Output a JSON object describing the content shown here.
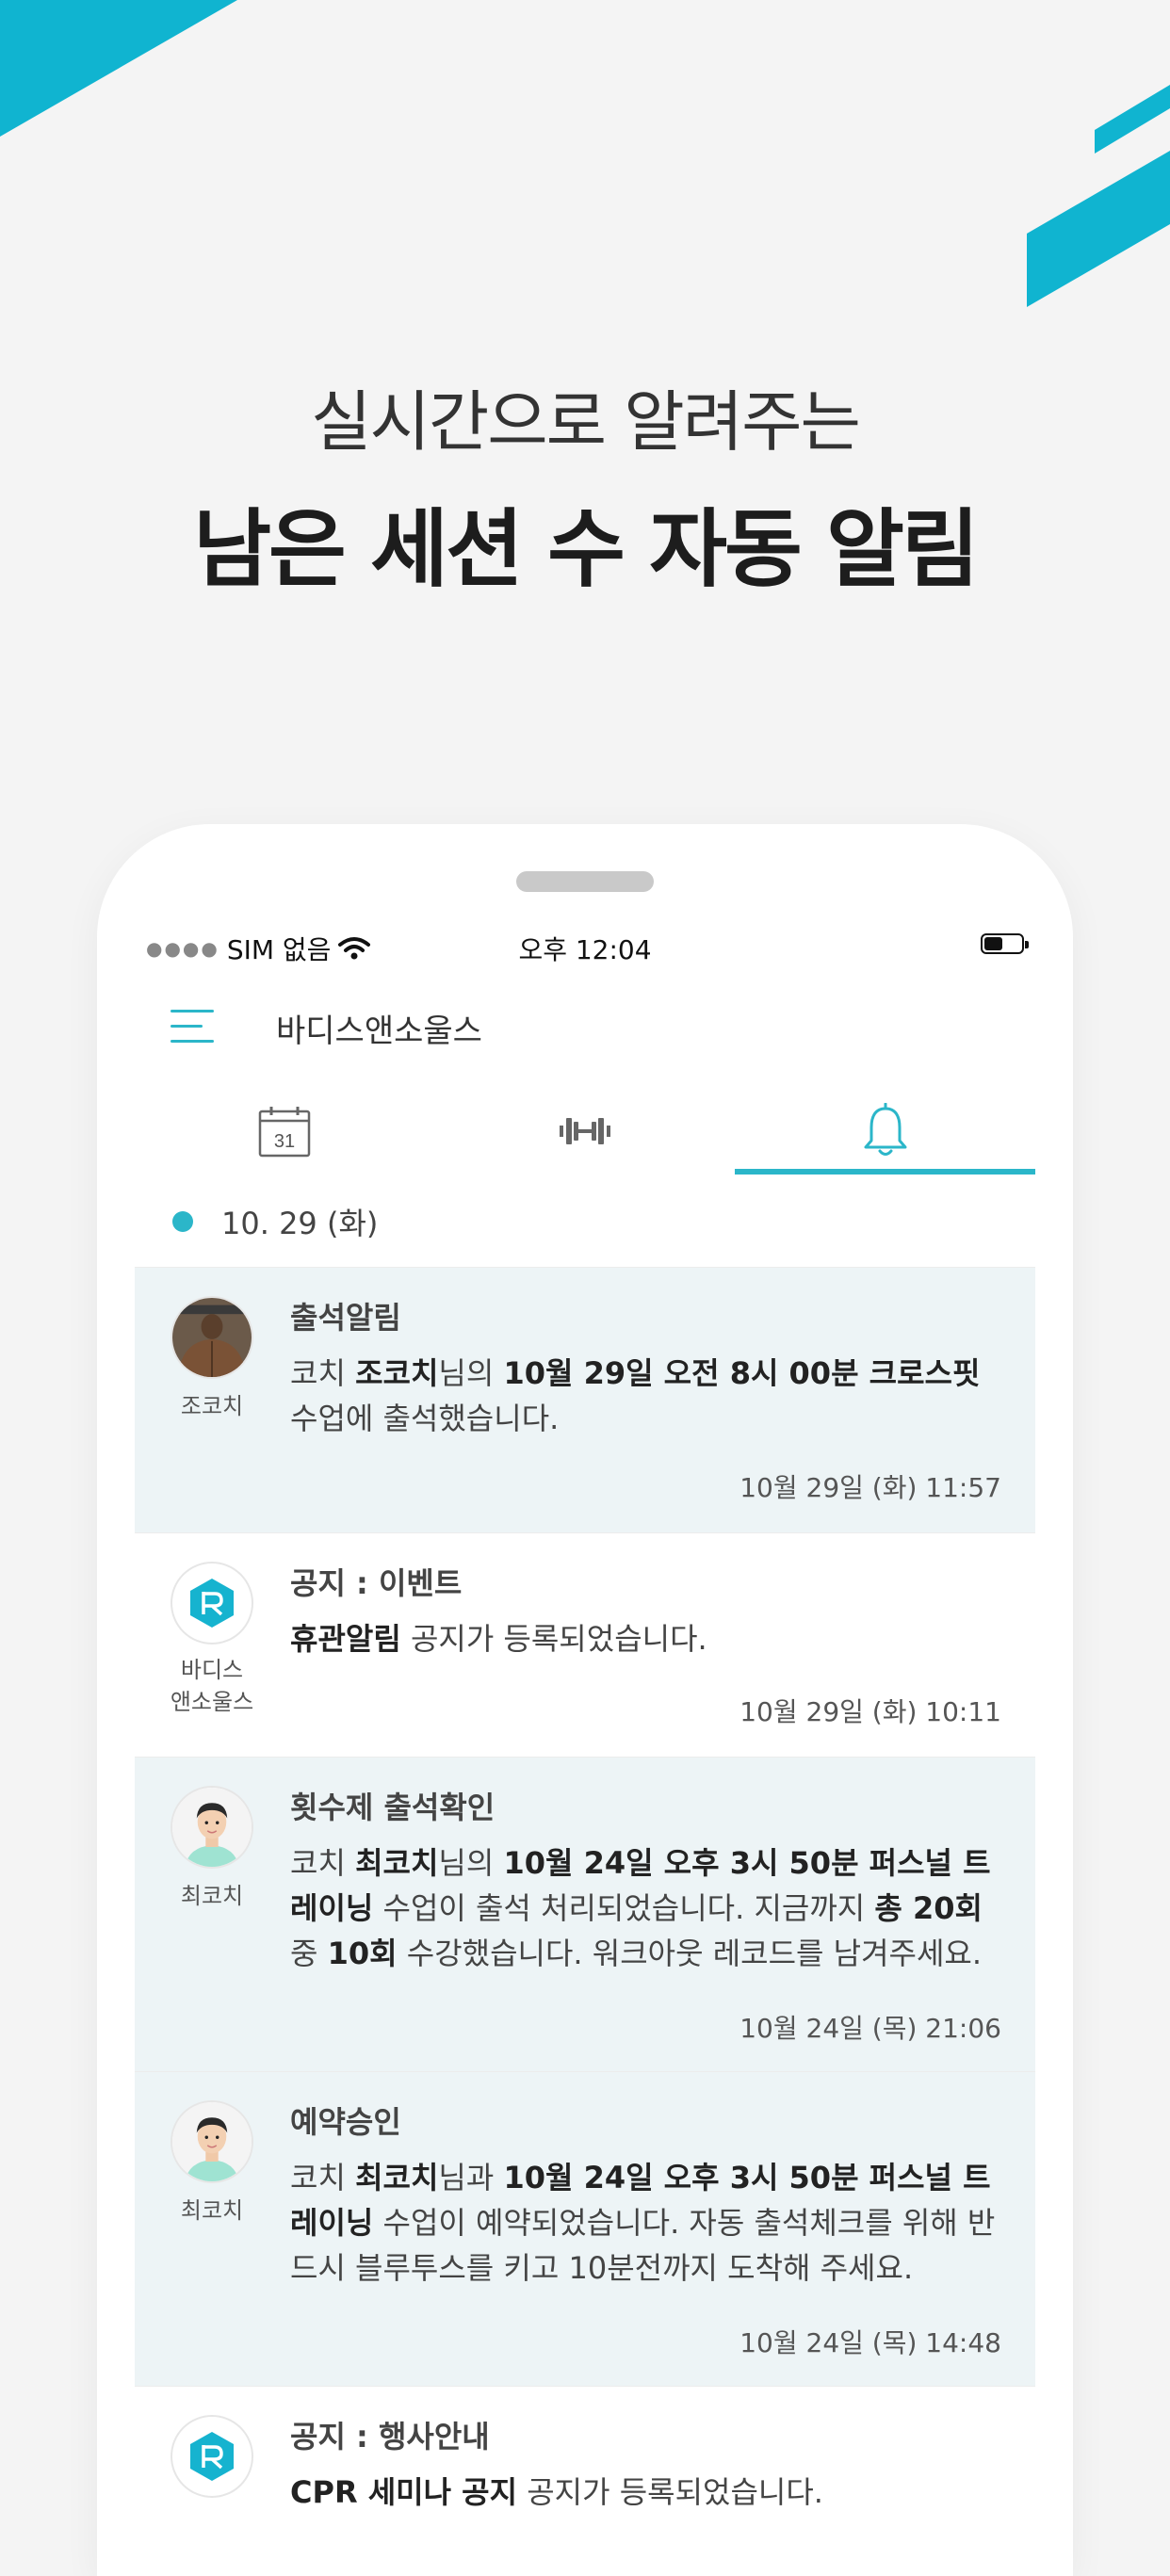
{
  "colors": {
    "accent": "#2bb6c9",
    "shaded_card": "#edf4f6",
    "background": "#f4f4f4"
  },
  "headline": {
    "sub": "실시간으로 알려주는",
    "main": "남은 세션 수 자동 알림"
  },
  "status_bar": {
    "carrier": "SIM 없음",
    "time": "오후 12:04",
    "battery_level": 0.5
  },
  "app": {
    "title": "바디스앤소울스",
    "menu_icon": "hamburger-menu-icon"
  },
  "tabs": [
    {
      "icon": "calendar-icon",
      "calendar_day": "31",
      "active": false
    },
    {
      "icon": "dumbbell-icon",
      "active": false
    },
    {
      "icon": "bell-icon",
      "active": true
    }
  ],
  "date_header": "10. 29 (화)",
  "notifications": [
    {
      "avatar": "coach-photo-back",
      "avatar_name": "조코치",
      "title": "출석알림",
      "body": [
        {
          "t": "코치 "
        },
        {
          "t": "조코치",
          "b": true
        },
        {
          "t": "님의 "
        },
        {
          "t": "10월 29일 오전 8시 00분 크로스핏",
          "b": true
        },
        {
          "t": " 수업에 출석했습니다."
        }
      ],
      "time": "10월 29일 (화) 11:57",
      "shaded": true
    },
    {
      "avatar": "brand-logo-icon",
      "avatar_name": "바디스\n앤소울스",
      "title": "공지 : 이벤트",
      "body": [
        {
          "t": "휴관알림",
          "b": true
        },
        {
          "t": " 공지가 등록되었습니다."
        }
      ],
      "time": "10월 29일 (화) 10:11",
      "shaded": false
    },
    {
      "avatar": "coach-photo-face",
      "avatar_name": "최코치",
      "title": "횟수제 출석확인",
      "body": [
        {
          "t": "코치 "
        },
        {
          "t": "최코치",
          "b": true
        },
        {
          "t": "님의 "
        },
        {
          "t": "10월 24일 오후 3시 50분 퍼스널 트레이닝",
          "b": true
        },
        {
          "t": " 수업이 출석 처리되었습니다. 지금까지 "
        },
        {
          "t": "총 20회",
          "b": true
        },
        {
          "t": " 중 "
        },
        {
          "t": "10회",
          "b": true
        },
        {
          "t": " 수강했습니다. 워크아웃 레코드를 남겨주세요."
        }
      ],
      "time": "10월 24일 (목) 21:06",
      "shaded": true
    },
    {
      "avatar": "coach-photo-face",
      "avatar_name": "최코치",
      "title": "예약승인",
      "body": [
        {
          "t": "코치 "
        },
        {
          "t": "최코치",
          "b": true
        },
        {
          "t": "님과 "
        },
        {
          "t": "10월 24일 오후 3시 50분 퍼스널 트레이닝",
          "b": true
        },
        {
          "t": " 수업이 예약되었습니다. 자동 출석체크를 위해 반드시 블루투스를 키고 10분전까지 도착해 주세요."
        }
      ],
      "time": "10월 24일 (목) 14:48",
      "shaded": true
    },
    {
      "avatar": "brand-logo-icon",
      "avatar_name": "",
      "title": "공지 : 행사안내",
      "body": [
        {
          "t": "CPR 세미나 공지",
          "b": true
        },
        {
          "t": " 공지가 등록되었습니다."
        }
      ],
      "time": "",
      "shaded": false
    }
  ]
}
